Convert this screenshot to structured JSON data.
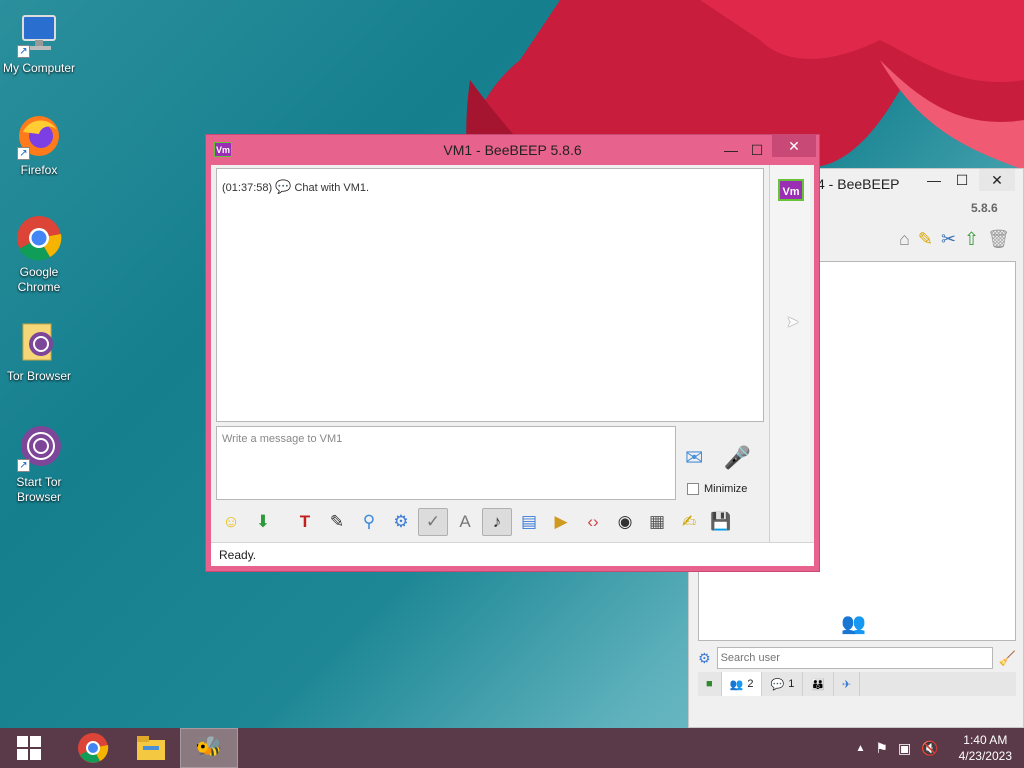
{
  "desktop": {
    "icons": [
      {
        "label": "My Computer"
      },
      {
        "label": "Firefox"
      },
      {
        "label": "Google Chrome"
      },
      {
        "label": "Tor Browser"
      },
      {
        "label": "Start Tor Browser"
      }
    ]
  },
  "chat_window": {
    "title": "VM1 - BeeBEEP 5.8.6",
    "badge": "Vm",
    "log": {
      "time": "(01:37:58)",
      "text": "Chat with VM1."
    },
    "message_placeholder": "Write a message to VM1",
    "minimize_label": "Minimize",
    "status": "Ready.",
    "toolbar_icons": [
      "emoticon-icon",
      "download-icon",
      "font-icon",
      "color-icon",
      "filter-icon",
      "settings-icon",
      "spellcheck-icon",
      "text-icon",
      "music-icon",
      "file-icon",
      "folder-icon",
      "code-icon",
      "screenshot-icon",
      "calendar-icon",
      "note-icon",
      "save-icon"
    ]
  },
  "main_window": {
    "title_partial": "4 - BeeBEEP",
    "version": "5.8.6",
    "search_placeholder": "Search user",
    "tabs": [
      {
        "icon": "users-online-icon",
        "count": ""
      },
      {
        "icon": "users-icon",
        "count": "2"
      },
      {
        "icon": "chats-icon",
        "count": "1"
      },
      {
        "icon": "groups-icon",
        "count": ""
      },
      {
        "icon": "files-icon",
        "count": ""
      }
    ]
  },
  "taskbar": {
    "time": "1:40 AM",
    "date": "4/23/2023"
  },
  "colors": {
    "chat_frame": "#e8628e",
    "taskbar": "#5a3a48",
    "badge": "#9a2fb3"
  }
}
